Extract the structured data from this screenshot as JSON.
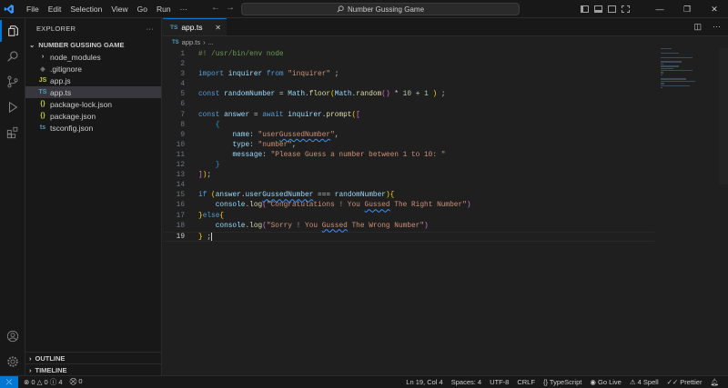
{
  "titlebar": {
    "menu": [
      "File",
      "Edit",
      "Selection",
      "View",
      "Go",
      "Run",
      "···"
    ],
    "search_text": "Number Gussing Game"
  },
  "explorer": {
    "title": "EXPLORER",
    "folder": "NUMBER GUSSING GAME",
    "items": [
      {
        "label": "node_modules",
        "icon": "chevron-right-icon",
        "glyph": "›",
        "color": "#cccccc"
      },
      {
        "label": ".gitignore",
        "icon": "gitignore-file-icon",
        "glyph": "◆",
        "color": "#6d6d6d"
      },
      {
        "label": "app.js",
        "icon": "javascript-file-icon",
        "glyph": "JS",
        "color": "#cbcb41"
      },
      {
        "label": "app.ts",
        "icon": "typescript-file-icon",
        "glyph": "TS",
        "color": "#519aba"
      },
      {
        "label": "package-lock.json",
        "icon": "json-file-icon",
        "glyph": "{}",
        "color": "#cbcb41"
      },
      {
        "label": "package.json",
        "icon": "json-file-icon",
        "glyph": "{}",
        "color": "#cbcb41"
      },
      {
        "label": "tsconfig.json",
        "icon": "tsconfig-file-icon",
        "glyph": "ts",
        "color": "#519aba"
      }
    ],
    "outline": "OUTLINE",
    "timeline": "TIMELINE"
  },
  "editor": {
    "tab_label": "app.ts",
    "tab_icon_text": "TS",
    "breadcrumb_file": "app.ts",
    "breadcrumb_sep": "›",
    "breadcrumb_more": "..."
  },
  "code_lines": [
    {
      "n": "1",
      "segs": [
        [
          "c",
          "#! /usr/bin/env node"
        ]
      ]
    },
    {
      "n": "2",
      "segs": []
    },
    {
      "n": "3",
      "segs": [
        [
          "k",
          "import "
        ],
        [
          "v",
          "inquirer "
        ],
        [
          "k",
          "from "
        ],
        [
          "s",
          "\"inquirer\""
        ],
        [
          "p",
          " ;"
        ]
      ]
    },
    {
      "n": "4",
      "segs": []
    },
    {
      "n": "5",
      "segs": [
        [
          "k",
          "const "
        ],
        [
          "v",
          "randomNumber"
        ],
        [
          "p",
          " = "
        ],
        [
          "v",
          "Math"
        ],
        [
          "p",
          "."
        ],
        [
          "f",
          "floor"
        ],
        [
          "b1",
          "("
        ],
        [
          "v",
          "Math"
        ],
        [
          "p",
          "."
        ],
        [
          "f",
          "random"
        ],
        [
          "b2",
          "()"
        ],
        [
          "p",
          " * "
        ],
        [
          "n",
          "10"
        ],
        [
          "p",
          " + "
        ],
        [
          "n",
          "1"
        ],
        [
          "p",
          " "
        ],
        [
          "b1",
          ")"
        ],
        [
          "p",
          " ;"
        ]
      ]
    },
    {
      "n": "6",
      "segs": []
    },
    {
      "n": "7",
      "segs": [
        [
          "k",
          "const "
        ],
        [
          "v",
          "answer"
        ],
        [
          "p",
          " = "
        ],
        [
          "k",
          "await "
        ],
        [
          "v",
          "inquirer"
        ],
        [
          "p",
          "."
        ],
        [
          "f",
          "prompt"
        ],
        [
          "b1",
          "("
        ],
        [
          "b2",
          "["
        ]
      ]
    },
    {
      "n": "8",
      "segs": [
        [
          "p",
          "    "
        ],
        [
          "b3",
          "{"
        ]
      ]
    },
    {
      "n": "9",
      "segs": [
        [
          "p",
          "        "
        ],
        [
          "v",
          "name"
        ],
        [
          "p",
          ": "
        ],
        [
          "s",
          "\"userGussedNumber\""
        ],
        [
          "p",
          ","
        ]
      ]
    },
    {
      "n": "10",
      "segs": [
        [
          "p",
          "        "
        ],
        [
          "v",
          "type"
        ],
        [
          "p",
          ": "
        ],
        [
          "s",
          "\"number\""
        ],
        [
          "p",
          ","
        ]
      ]
    },
    {
      "n": "11",
      "segs": [
        [
          "p",
          "        "
        ],
        [
          "v",
          "message"
        ],
        [
          "p",
          ": "
        ],
        [
          "s",
          "\"Please Guess a number between 1 to 10: \""
        ]
      ]
    },
    {
      "n": "12",
      "segs": [
        [
          "p",
          "    "
        ],
        [
          "b3",
          "}"
        ]
      ]
    },
    {
      "n": "13",
      "segs": [
        [
          "b2",
          "]"
        ],
        [
          "b1",
          ")"
        ],
        [
          "p",
          ";"
        ]
      ]
    },
    {
      "n": "14",
      "segs": []
    },
    {
      "n": "15",
      "segs": [
        [
          "k",
          "if "
        ],
        [
          "b1",
          "("
        ],
        [
          "v",
          "answer"
        ],
        [
          "p",
          "."
        ],
        [
          "v",
          "userGussedNumber"
        ],
        [
          "p",
          " === "
        ],
        [
          "v",
          "randomNumber"
        ],
        [
          "b1",
          ")"
        ],
        [
          "b1",
          "{"
        ]
      ]
    },
    {
      "n": "16",
      "segs": [
        [
          "p",
          "    "
        ],
        [
          "v",
          "console"
        ],
        [
          "p",
          "."
        ],
        [
          "f",
          "log"
        ],
        [
          "b2",
          "("
        ],
        [
          "s",
          "\"Congratulations ! You Gussed The Right Number\""
        ],
        [
          "b2",
          ")"
        ]
      ]
    },
    {
      "n": "17",
      "segs": [
        [
          "b1",
          "}"
        ],
        [
          "k",
          "else"
        ],
        [
          "b1",
          "{"
        ]
      ]
    },
    {
      "n": "18",
      "segs": [
        [
          "p",
          "    "
        ],
        [
          "v",
          "console"
        ],
        [
          "p",
          "."
        ],
        [
          "f",
          "log"
        ],
        [
          "b2",
          "("
        ],
        [
          "s",
          "\"Sorry ! You Gussed The Wrong Number\""
        ],
        [
          "b2",
          ")"
        ]
      ]
    },
    {
      "n": "19",
      "segs": [
        [
          "b1",
          "}"
        ],
        [
          "p",
          " ;"
        ]
      ]
    }
  ],
  "status": {
    "errors": "0",
    "warnings": "0",
    "info": "4",
    "ports": "0",
    "position": "Ln 19, Col 4",
    "spaces": "Spaces: 4",
    "encoding": "UTF-8",
    "eol": "CRLF",
    "language": "TypeScript",
    "golive": "Go Live",
    "spell": "4 Spell",
    "prettier": "Prettier"
  }
}
